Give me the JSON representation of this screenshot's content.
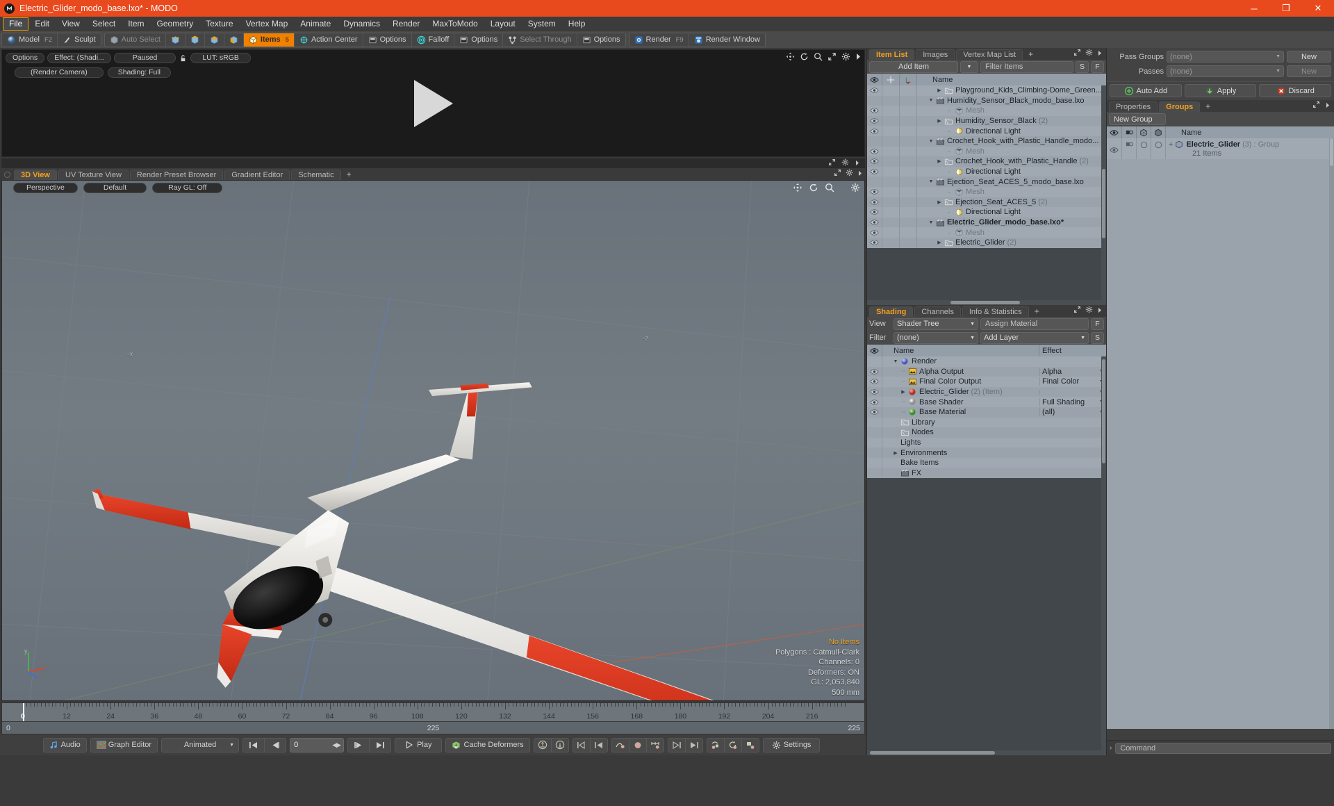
{
  "titlebar": {
    "title": "Electric_Glider_modo_base.lxo* - MODO",
    "app_icon": "modo-logo-icon",
    "minimize": "─",
    "maximize": "❐",
    "close": "✕"
  },
  "menubar": {
    "items": [
      "File",
      "Edit",
      "View",
      "Select",
      "Item",
      "Geometry",
      "Texture",
      "Vertex Map",
      "Animate",
      "Dynamics",
      "Render",
      "MaxToModo",
      "Layout",
      "System",
      "Help"
    ],
    "active_index": 0
  },
  "modebar": {
    "groups": [
      {
        "buttons": [
          {
            "label": "Model",
            "hotkey": "F2",
            "icon": "sphere-icon",
            "state": "normal"
          },
          {
            "label": "Sculpt",
            "hotkey": "",
            "icon": "brush-icon",
            "state": "normal"
          }
        ]
      },
      {
        "buttons": [
          {
            "label": "Auto Select",
            "hotkey": "",
            "icon": "cube-icon",
            "state": "dim"
          },
          {
            "label": "",
            "hotkey": "",
            "icon": "vertex-icon",
            "state": "normal"
          },
          {
            "label": "",
            "hotkey": "",
            "icon": "edge-icon",
            "state": "normal"
          },
          {
            "label": "",
            "hotkey": "",
            "icon": "polygon-icon",
            "state": "normal"
          },
          {
            "label": "",
            "hotkey": "",
            "icon": "material-icon",
            "state": "normal"
          },
          {
            "label": "Items",
            "hotkey": "5",
            "icon": "items-cube-icon",
            "state": "on"
          },
          {
            "label": "Action Center",
            "hotkey": "",
            "icon": "action-center-icon",
            "state": "normal"
          },
          {
            "label": "Options",
            "hotkey": "",
            "icon": "options-icon",
            "state": "normal"
          },
          {
            "label": "Falloff",
            "hotkey": "",
            "icon": "falloff-icon",
            "state": "normal"
          },
          {
            "label": "Options",
            "hotkey": "",
            "icon": "options-icon",
            "state": "normal"
          },
          {
            "label": "Select Through",
            "hotkey": "",
            "icon": "select-through-icon",
            "state": "dim"
          },
          {
            "label": "Options",
            "hotkey": "",
            "icon": "options-icon",
            "state": "normal"
          }
        ]
      },
      {
        "buttons": [
          {
            "label": "Render",
            "hotkey": "F9",
            "icon": "render-icon",
            "state": "normal"
          },
          {
            "label": "Render Window",
            "hotkey": "",
            "icon": "render-window-icon",
            "state": "normal"
          }
        ]
      }
    ]
  },
  "render_preview": {
    "row1": [
      "Options",
      "Effect: (Shadi...",
      "Paused",
      "LUT: sRGB"
    ],
    "lock_icon": "unlock-icon",
    "row2": [
      "(Render Camera)",
      "Shading: Full"
    ],
    "tool_icons": [
      "pan-icon",
      "rotate-icon",
      "zoom-icon",
      "fit-icon",
      "gear-icon",
      "chevron-right-icon"
    ],
    "bottom_icons": [
      "fit-icon",
      "gear-icon",
      "chevron-right-icon"
    ],
    "play_overlay": "play-triangle-icon"
  },
  "viewport": {
    "tabs": [
      "3D View",
      "UV Texture View",
      "Render Preset Browser",
      "Gradient Editor",
      "Schematic"
    ],
    "selected_tab": "3D View",
    "tab_plus": "+",
    "header_right_icons": [
      "fit-icon",
      "gear-icon",
      "chevron-right-icon"
    ],
    "overlay_pills": [
      "Perspective",
      "Default",
      "Ray GL: Off"
    ],
    "overlay_icons": [
      "pan-icon",
      "rotate-icon",
      "zoom-icon",
      "gear-icon"
    ],
    "axis_labels": {
      "x": "-x",
      "z": "-z",
      "y": "y"
    },
    "stats": {
      "selection": "No Items",
      "polygons": "Polygons : Catmull-Clark",
      "channels": "Channels: 0",
      "deformers": "Deformers: ON",
      "gl": "GL: 2,053,840",
      "grid": "500 mm"
    }
  },
  "timeline": {
    "ticks": [
      0,
      12,
      24,
      36,
      48,
      60,
      72,
      84,
      96,
      108,
      120,
      132,
      144,
      156,
      168,
      180,
      192,
      204,
      216
    ],
    "range_start": "0",
    "range_center": "225",
    "range_end": "225",
    "playhead_frame": 0
  },
  "playbar": {
    "audio": "Audio",
    "graph_editor": "Graph Editor",
    "mode": "Animated",
    "frame_value": "0",
    "play": "Play",
    "cache_deformers": "Cache Deformers",
    "settings": "Settings",
    "transport_icons": [
      "go-start-icon",
      "step-back-icon",
      "step-forward-icon",
      "go-end-icon"
    ],
    "key_icons": [
      "key-up-icon",
      "key-down-icon",
      "prev-key-icon",
      "prev-keyframe-icon",
      "curve-key-icon",
      "create-key-icon",
      "range-key-icon",
      "next-key-icon",
      "last-key-icon",
      "auto-key-icon",
      "reset-key-icon",
      "delete-key-icon"
    ]
  },
  "item_list": {
    "tabs": [
      "Item List",
      "Images",
      "Vertex Map List"
    ],
    "selected_tab": "Item List",
    "tab_plus": "+",
    "add_item": "Add Item",
    "filter_placeholder": "Filter Items",
    "btn_s": "S",
    "btn_f": "F",
    "columns": {
      "eye": "eye-icon",
      "lock": "move-lock-icon",
      "axis": "axis-icon",
      "name": "Name"
    },
    "rows": [
      {
        "indent": 2,
        "tri": "collapsed",
        "icon": "folder-icon",
        "name": "Playground_Kids_Climbing-Dome_Green...",
        "suffix": "",
        "eye": true,
        "bold": false,
        "dim": false
      },
      {
        "indent": 1,
        "tri": "expanded",
        "icon": "scene-icon",
        "name": "Humidity_Sensor_Black_modo_base.lxo",
        "suffix": "",
        "eye": false,
        "bold": false,
        "dim": false
      },
      {
        "indent": 2,
        "tri": "none",
        "icon": "mesh-icon",
        "name": "Mesh",
        "suffix": "",
        "eye": true,
        "bold": false,
        "dim": true
      },
      {
        "indent": 2,
        "tri": "collapsed",
        "icon": "folder-icon",
        "name": "Humidity_Sensor_Black",
        "suffix": "(2)",
        "eye": true,
        "bold": false,
        "dim": false
      },
      {
        "indent": 2,
        "tri": "none",
        "icon": "light-icon",
        "name": "Directional Light",
        "suffix": "",
        "eye": true,
        "bold": false,
        "dim": false
      },
      {
        "indent": 1,
        "tri": "expanded",
        "icon": "scene-icon",
        "name": "Crochet_Hook_with_Plastic_Handle_modo...",
        "suffix": "",
        "eye": false,
        "bold": false,
        "dim": false
      },
      {
        "indent": 2,
        "tri": "none",
        "icon": "mesh-icon",
        "name": "Mesh",
        "suffix": "",
        "eye": true,
        "bold": false,
        "dim": true
      },
      {
        "indent": 2,
        "tri": "collapsed",
        "icon": "folder-icon",
        "name": "Crochet_Hook_with_Plastic_Handle",
        "suffix": "(2)",
        "eye": true,
        "bold": false,
        "dim": false
      },
      {
        "indent": 2,
        "tri": "none",
        "icon": "light-icon",
        "name": "Directional Light",
        "suffix": "",
        "eye": true,
        "bold": false,
        "dim": false
      },
      {
        "indent": 1,
        "tri": "expanded",
        "icon": "scene-icon",
        "name": "Ejection_Seat_ACES_5_modo_base.lxo",
        "suffix": "",
        "eye": false,
        "bold": false,
        "dim": false
      },
      {
        "indent": 2,
        "tri": "none",
        "icon": "mesh-icon",
        "name": "Mesh",
        "suffix": "",
        "eye": true,
        "bold": false,
        "dim": true
      },
      {
        "indent": 2,
        "tri": "collapsed",
        "icon": "folder-icon",
        "name": "Ejection_Seat_ACES_5",
        "suffix": "(2)",
        "eye": true,
        "bold": false,
        "dim": false
      },
      {
        "indent": 2,
        "tri": "none",
        "icon": "light-icon",
        "name": "Directional Light",
        "suffix": "",
        "eye": true,
        "bold": false,
        "dim": false
      },
      {
        "indent": 1,
        "tri": "expanded",
        "icon": "scene-icon",
        "name": "Electric_Glider_modo_base.lxo*",
        "suffix": "",
        "eye": true,
        "bold": true,
        "dim": false
      },
      {
        "indent": 2,
        "tri": "none",
        "icon": "mesh-icon",
        "name": "Mesh",
        "suffix": "",
        "eye": true,
        "bold": false,
        "dim": true
      },
      {
        "indent": 2,
        "tri": "collapsed",
        "icon": "folder-icon",
        "name": "Electric_Glider",
        "suffix": "(2)",
        "eye": true,
        "bold": false,
        "dim": false
      }
    ]
  },
  "shading": {
    "tabs": [
      "Shading",
      "Channels",
      "Info & Statistics"
    ],
    "selected_tab": "Shading",
    "tab_plus": "+",
    "view_label": "View",
    "view_value": "Shader Tree",
    "assign_material": "Assign Material",
    "btn_f": "F",
    "filter_label": "Filter",
    "filter_value": "(none)",
    "add_layer": "Add Layer",
    "btn_s": "S",
    "col_name": "Name",
    "col_effect": "Effect",
    "rows": [
      {
        "indent": 1,
        "tri": "expanded",
        "icon": "render-sphere-icon",
        "color": "#6f7fd4",
        "name": "Render",
        "suffix": "",
        "effect": "",
        "eye": false,
        "dropdown": false
      },
      {
        "indent": 2,
        "tri": "dash",
        "icon": "image-icon",
        "color": "#c8a23c",
        "name": "Alpha Output",
        "suffix": "",
        "effect": "Alpha",
        "eye": true,
        "dropdown": true
      },
      {
        "indent": 2,
        "tri": "dash",
        "icon": "image-icon",
        "color": "#c8a23c",
        "name": "Final Color Output",
        "suffix": "",
        "effect": "Final Color",
        "eye": true,
        "dropdown": true
      },
      {
        "indent": 2,
        "tri": "collapsed",
        "icon": "material-sphere-icon",
        "color": "#cf3a28",
        "name": "Electric_Glider",
        "suffix": "(2) (Item)",
        "effect": "",
        "eye": true,
        "dropdown": true
      },
      {
        "indent": 2,
        "tri": "dash",
        "icon": "shader-sphere-icon",
        "color": "#d8d8d8",
        "name": "Base Shader",
        "suffix": "",
        "effect": "Full Shading",
        "eye": true,
        "dropdown": true
      },
      {
        "indent": 2,
        "tri": "dash",
        "icon": "material-sphere-icon",
        "color": "#5bb24a",
        "name": "Base Material",
        "suffix": "",
        "effect": "(all)",
        "eye": true,
        "dropdown": true
      },
      {
        "indent": 1,
        "tri": "none",
        "icon": "folder-icon",
        "color": "",
        "name": "Library",
        "suffix": "",
        "effect": "",
        "eye": false,
        "dropdown": false
      },
      {
        "indent": 1,
        "tri": "none",
        "icon": "folder-icon",
        "color": "",
        "name": "Nodes",
        "suffix": "",
        "effect": "",
        "eye": false,
        "dropdown": false
      },
      {
        "indent": 1,
        "tri": "none",
        "icon": "none",
        "color": "",
        "name": "Lights",
        "suffix": "",
        "effect": "",
        "eye": false,
        "dropdown": false
      },
      {
        "indent": 1,
        "tri": "collapsed",
        "icon": "none",
        "color": "",
        "name": "Environments",
        "suffix": "",
        "effect": "",
        "eye": false,
        "dropdown": false
      },
      {
        "indent": 1,
        "tri": "none",
        "icon": "none",
        "color": "",
        "name": "Bake Items",
        "suffix": "",
        "effect": "",
        "eye": false,
        "dropdown": false
      },
      {
        "indent": 1,
        "tri": "none",
        "icon": "scene-icon",
        "color": "",
        "name": "FX",
        "suffix": "",
        "effect": "",
        "eye": false,
        "dropdown": false
      }
    ]
  },
  "passes": {
    "pass_groups_label": "Pass Groups",
    "pass_groups_value": "(none)",
    "pass_groups_new": "New",
    "passes_label": "Passes",
    "passes_value": "(none)",
    "passes_new": "New",
    "auto_add": "Auto Add",
    "apply": "Apply",
    "discard": "Discard"
  },
  "groups_panel": {
    "tabs": [
      "Properties",
      "Groups"
    ],
    "selected_tab": "Groups",
    "tab_plus": "+",
    "new_group": "New Group",
    "columns": {
      "eye": "eye-icon",
      "render": "render-toggle-icon",
      "wire": "wire-icon",
      "shade": "shade-icon",
      "name": "Name"
    },
    "row": {
      "name": "Electric_Glider",
      "count": "(3)",
      "type": ": Group",
      "sub": "21 Items",
      "expand": "+"
    }
  },
  "command_bar": {
    "prompt": "›",
    "placeholder": "Command"
  },
  "colors": {
    "accent": "#f5a01e",
    "title_bg": "#e8491d",
    "panel_bg": "#3c3c3c",
    "list_bg": "#a0a9b2",
    "header_bg": "#949ea8",
    "viewport_bg": "#6e777e",
    "model_red": "#d93a1f",
    "model_white": "#eceae6"
  }
}
